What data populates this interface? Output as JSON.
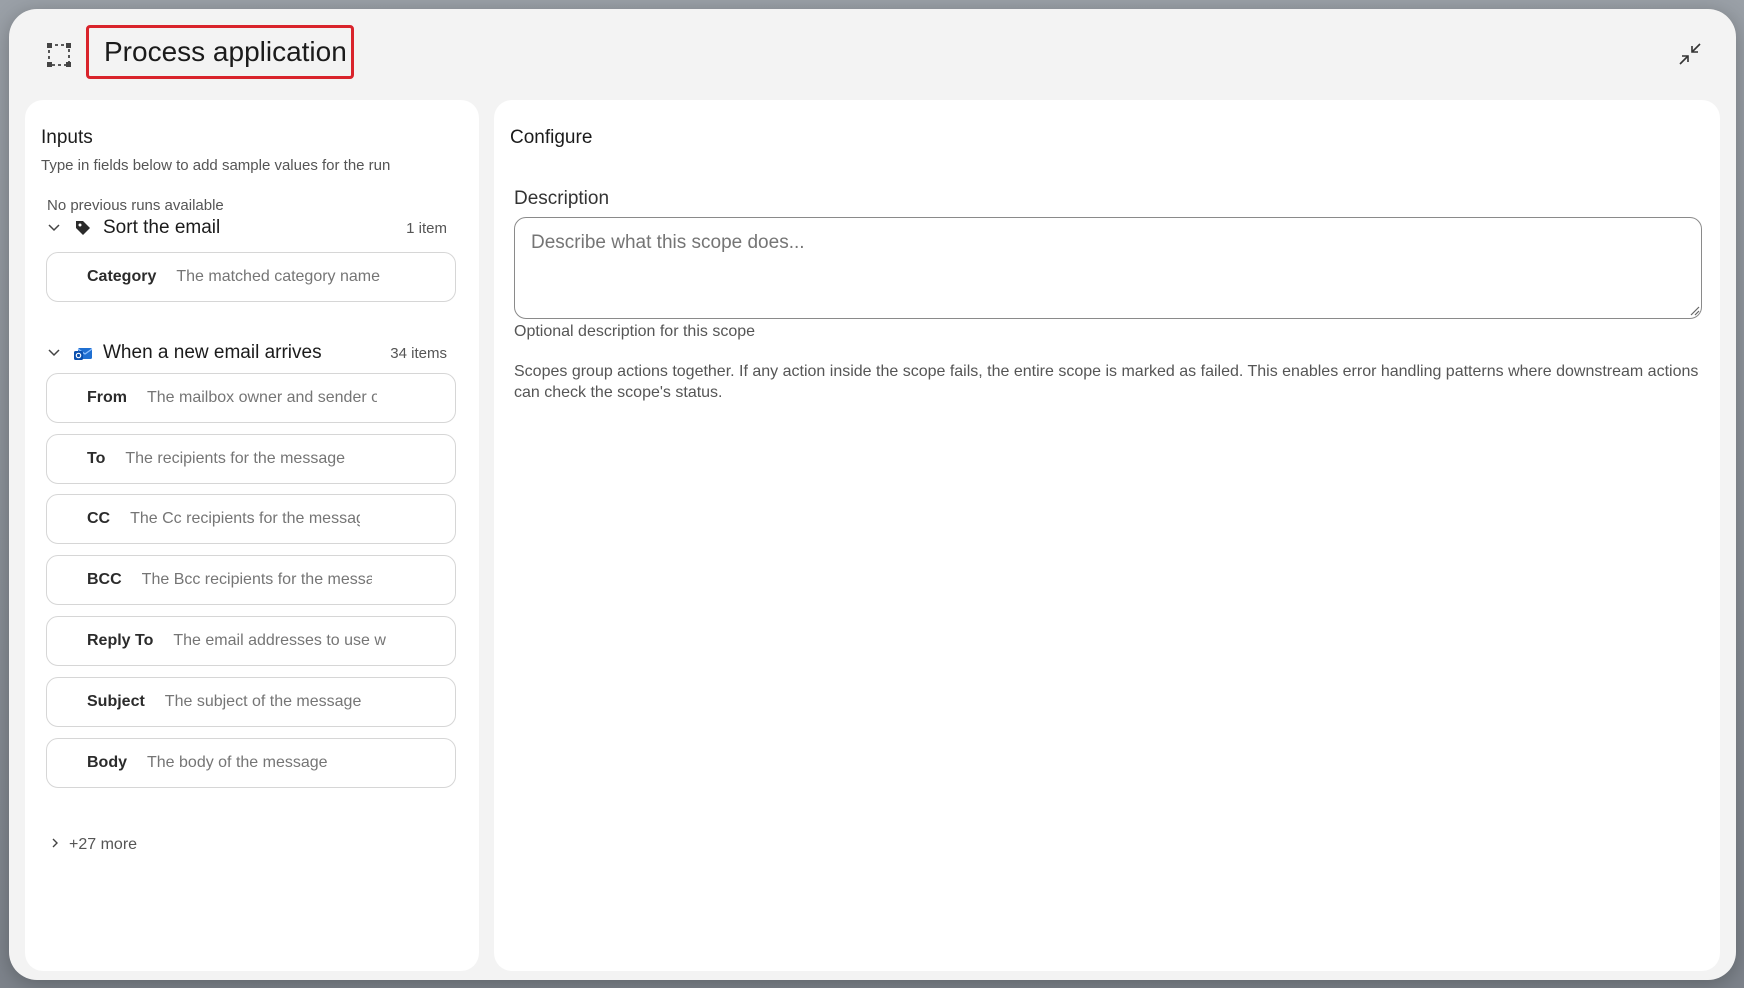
{
  "header": {
    "title": "Process application",
    "scope_icon": "scope-icon",
    "collapse_icon": "collapse-icon"
  },
  "inputs": {
    "heading": "Inputs",
    "subtitle": "Type in fields below to add sample values for the run",
    "no_runs": "No previous runs available",
    "groups": [
      {
        "title": "Sort the email",
        "count": "1 item",
        "icon": "tag-icon",
        "fields": [
          {
            "label": "Category",
            "placeholder": "The matched category name"
          }
        ]
      },
      {
        "title": "When a new email arrives",
        "count": "34 items",
        "icon": "outlook-mail-icon",
        "fields": [
          {
            "label": "From",
            "placeholder": "The mailbox owner and sender of"
          },
          {
            "label": "To",
            "placeholder": "The recipients for the message"
          },
          {
            "label": "CC",
            "placeholder": "The Cc recipients for the message"
          },
          {
            "label": "BCC",
            "placeholder": "The Bcc recipients for the message"
          },
          {
            "label": "Reply To",
            "placeholder": "The email addresses to use w"
          },
          {
            "label": "Subject",
            "placeholder": "The subject of the message"
          },
          {
            "label": "Body",
            "placeholder": "The body of the message"
          }
        ]
      }
    ],
    "more": "+27 more"
  },
  "configure": {
    "heading": "Configure",
    "description_label": "Description",
    "description_placeholder": "Describe what this scope does...",
    "description_help": "Optional description for this scope",
    "info": "Scopes group actions together. If any action inside the scope fails, the entire scope is marked as failed. This enables error handling patterns where downstream actions can check the scope's status."
  },
  "colors": {
    "highlight_border": "#d9232b",
    "modal_bg": "#f3f3f3",
    "panel_bg": "#ffffff"
  }
}
